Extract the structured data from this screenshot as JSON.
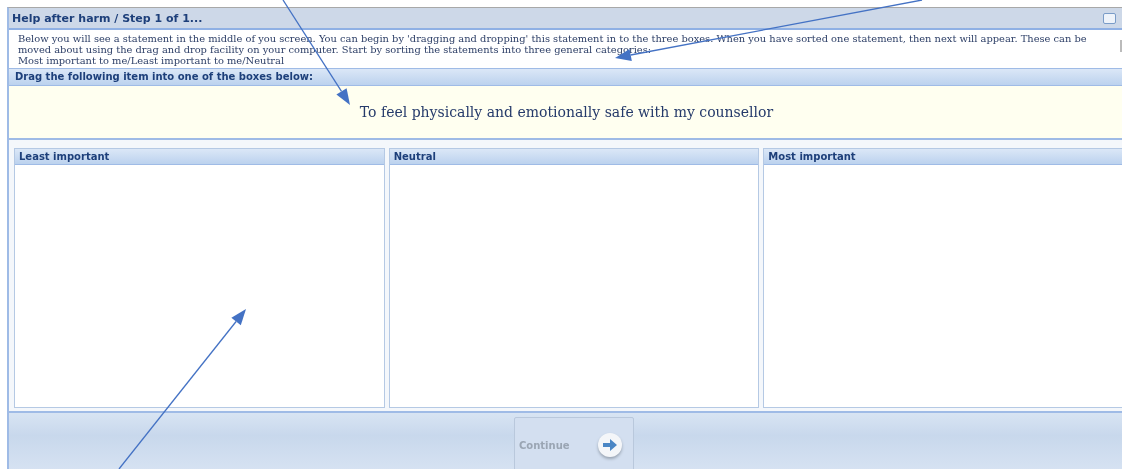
{
  "window": {
    "title": "Help after harm / Step 1 of 1..."
  },
  "instructions": [
    "Below you will see a statement in the middle of you screen. You can begin by 'dragging and dropping' this statement in to the three boxes. When you have sorted one statement, then next will appear. These can be moved about using the drag and drop facility on your computer. Start by sorting the statements into three general categories:",
    "Most important to me/Least important to me/Neutral"
  ],
  "drag_area": {
    "heading": "Drag the following item into one of the boxes below:",
    "item": "To feel physically and emotionally safe with my counsellor"
  },
  "boxes": [
    {
      "title": "Least important"
    },
    {
      "title": "Neutral"
    },
    {
      "title": "Most important"
    }
  ],
  "continue_button": {
    "label": "Continue",
    "disabled": true
  }
}
